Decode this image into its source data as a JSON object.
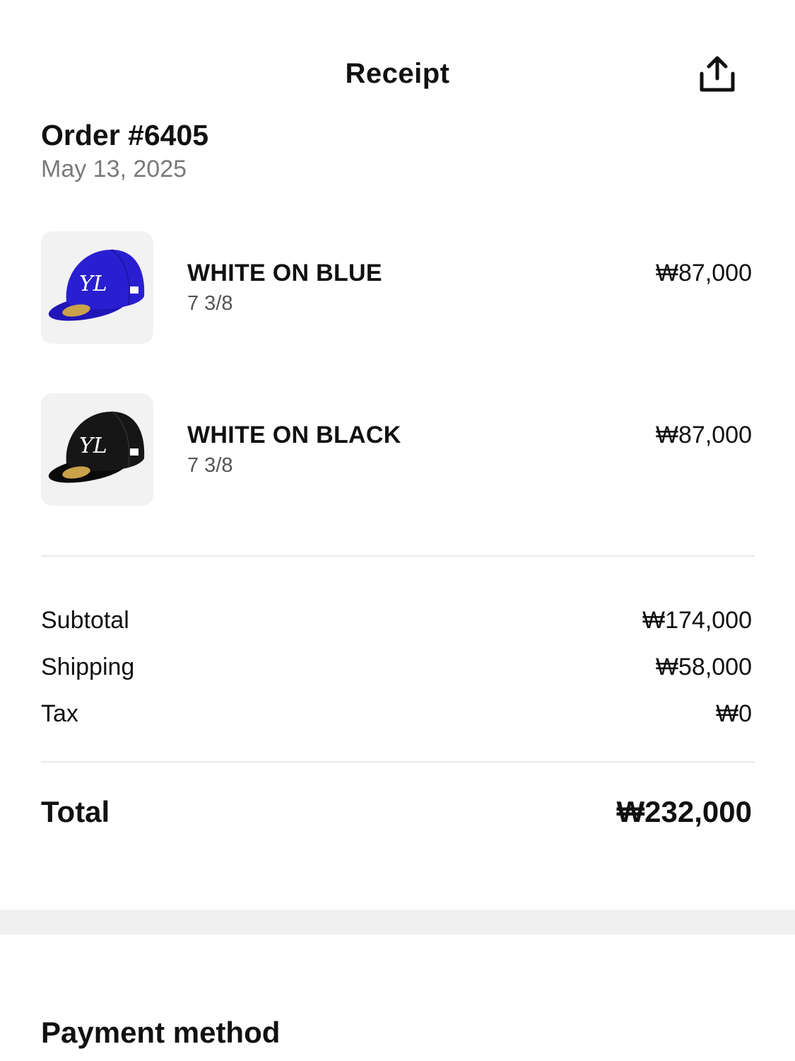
{
  "header": {
    "title": "Receipt",
    "share_icon": "share-upload-icon"
  },
  "order": {
    "title": "Order #6405",
    "date": "May 13, 2025"
  },
  "items": [
    {
      "name": "WHITE ON BLUE",
      "size": "7 3/8",
      "price": "₩87,000",
      "cap_color": "#2a1fd0",
      "thumb_icon": "blue-cap-image"
    },
    {
      "name": "WHITE ON BLACK",
      "size": "7 3/8",
      "price": "₩87,000",
      "cap_color": "#121212",
      "thumb_icon": "black-cap-image"
    }
  ],
  "summary": {
    "subtotal_label": "Subtotal",
    "subtotal_value": "₩174,000",
    "shipping_label": "Shipping",
    "shipping_value": "₩58,000",
    "tax_label": "Tax",
    "tax_value": "₩0",
    "total_label": "Total",
    "total_value": "₩232,000"
  },
  "payment": {
    "title": "Payment method"
  },
  "colors": {
    "text": "#111111",
    "muted": "#7a7a7a",
    "divider": "#e9e9e9",
    "thumb_bg": "#f2f2f2",
    "section_gap": "#f0f0f0"
  }
}
